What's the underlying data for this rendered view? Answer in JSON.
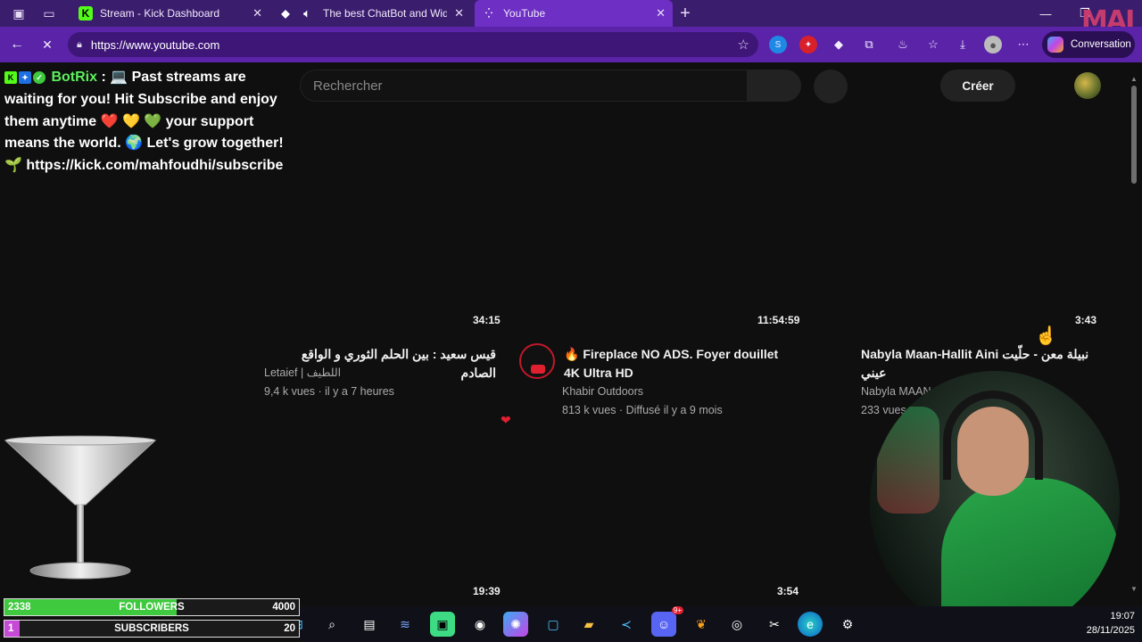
{
  "browser": {
    "tabs": [
      {
        "title": "Stream - Kick Dashboard",
        "icon": "kick-icon",
        "active": false
      },
      {
        "title": "The best ChatBot and Widge",
        "icon": "botrix-icon",
        "active": false
      },
      {
        "title": "YouTube",
        "icon": "loading-icon",
        "active": true
      }
    ],
    "url": "https://www.youtube.com",
    "copilot_label": "Conversation"
  },
  "youtube": {
    "search_placeholder": "Rechercher",
    "create_label": "Créer",
    "videos": [
      {
        "duration": "34:15",
        "title": "قيس سعيد : بين الحلم الثوري و الواقع الصادم",
        "channel": "Letaief | اللطيف",
        "meta": "9,4 k vues · il y a 7 heures"
      },
      {
        "duration": "11:54:59",
        "title": "🔥 Fireplace NO ADS. Foyer douillet 4K Ultra HD",
        "channel": "Khabir Outdoors",
        "meta": "813 k vues · Diffusé il y a 9 mois"
      },
      {
        "duration": "3:43",
        "title": "Nabyla Maan-Hallit Aini نبيلة معن - حلّيت عيني",
        "channel": "Nabyla MAAN",
        "meta": "233 vues"
      }
    ],
    "next_row_durations": [
      "19:39",
      "3:54"
    ]
  },
  "chat_overlay": {
    "bot_name": "BotRix",
    "message": " : 💻 Past streams are waiting for you! Hit Subscribe and enjoy them anytime ❤️ 💛 💚 your support means the world. 🌍 Let's grow together! 🌱 https://kick.com/mahfoudhi/subscribe"
  },
  "goals": [
    {
      "current": "2338",
      "label": "FOLLOWERS",
      "max": "4000",
      "fraction": 0.5845
    },
    {
      "current": "1",
      "label": "SUBSCRIBERS",
      "max": "20",
      "fraction": 0.05
    }
  ],
  "taskbar": {
    "time": "19:07",
    "date": "28/11/2025",
    "discord_badge": "9+"
  },
  "overlay_logo": "MAI",
  "colors": {
    "tab_bar": "#3b1d6e",
    "nav_bar": "#5a23a8",
    "youtube_bg": "#0f0f0f",
    "goal_fill": "#3ec93e",
    "bot_name": "#5cf05c"
  }
}
